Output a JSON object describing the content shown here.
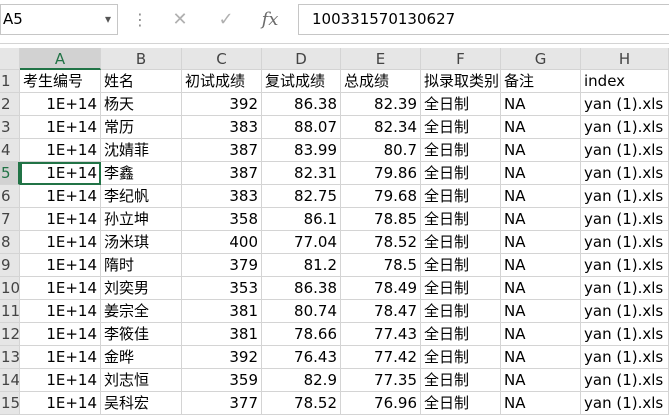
{
  "name_box": {
    "value": "A5"
  },
  "formula_bar": {
    "cancel_icon": "✕",
    "enter_icon": "✓",
    "function_icon": "fx",
    "value": "100331570130627"
  },
  "columns": [
    "A",
    "B",
    "C",
    "D",
    "E",
    "F",
    "G",
    "H"
  ],
  "selected_column": "A",
  "selected_row": "5",
  "rows": [
    {
      "num": "1",
      "cells": [
        "考生编号",
        "姓名",
        "初试成绩",
        "复试成绩",
        "总成绩",
        "拟录取类别",
        "备注",
        "index"
      ]
    },
    {
      "num": "2",
      "cells": [
        "1E+14",
        "杨天",
        "392",
        "86.38",
        "82.39",
        "全日制",
        "NA",
        "yan (1).xls"
      ]
    },
    {
      "num": "3",
      "cells": [
        "1E+14",
        "常历",
        "383",
        "88.07",
        "82.34",
        "全日制",
        "NA",
        "yan (1).xls"
      ]
    },
    {
      "num": "4",
      "cells": [
        "1E+14",
        "沈婧菲",
        "387",
        "83.99",
        "80.7",
        "全日制",
        "NA",
        "yan (1).xls"
      ]
    },
    {
      "num": "5",
      "cells": [
        "1E+14",
        "李鑫",
        "387",
        "82.31",
        "79.86",
        "全日制",
        "NA",
        "yan (1).xls"
      ]
    },
    {
      "num": "6",
      "cells": [
        "1E+14",
        "李纪帆",
        "383",
        "82.75",
        "79.68",
        "全日制",
        "NA",
        "yan (1).xls"
      ]
    },
    {
      "num": "7",
      "cells": [
        "1E+14",
        "孙立坤",
        "358",
        "86.1",
        "78.85",
        "全日制",
        "NA",
        "yan (1).xls"
      ]
    },
    {
      "num": "8",
      "cells": [
        "1E+14",
        "汤米琪",
        "400",
        "77.04",
        "78.52",
        "全日制",
        "NA",
        "yan (1).xls"
      ]
    },
    {
      "num": "9",
      "cells": [
        "1E+14",
        "隋时",
        "379",
        "81.2",
        "78.5",
        "全日制",
        "NA",
        "yan (1).xls"
      ]
    },
    {
      "num": "10",
      "cells": [
        "1E+14",
        "刘奕男",
        "353",
        "86.38",
        "78.49",
        "全日制",
        "NA",
        "yan (1).xls"
      ]
    },
    {
      "num": "11",
      "cells": [
        "1E+14",
        "姜宗全",
        "381",
        "80.74",
        "78.47",
        "全日制",
        "NA",
        "yan (1).xls"
      ]
    },
    {
      "num": "12",
      "cells": [
        "1E+14",
        "李筱佳",
        "381",
        "78.66",
        "77.43",
        "全日制",
        "NA",
        "yan (1).xls"
      ]
    },
    {
      "num": "13",
      "cells": [
        "1E+14",
        "金晔",
        "392",
        "76.43",
        "77.42",
        "全日制",
        "NA",
        "yan (1).xls"
      ]
    },
    {
      "num": "14",
      "cells": [
        "1E+14",
        "刘志恒",
        "359",
        "82.9",
        "77.35",
        "全日制",
        "NA",
        "yan (1).xls"
      ]
    },
    {
      "num": "15",
      "cells": [
        "1E+14",
        "吴科宏",
        "377",
        "78.52",
        "76.96",
        "全日制",
        "NA",
        "yan (1).xls"
      ]
    }
  ],
  "colors": {
    "accent": "#217346",
    "header_bg": "#e6e6e6",
    "gridline": "#d4d4d4"
  }
}
